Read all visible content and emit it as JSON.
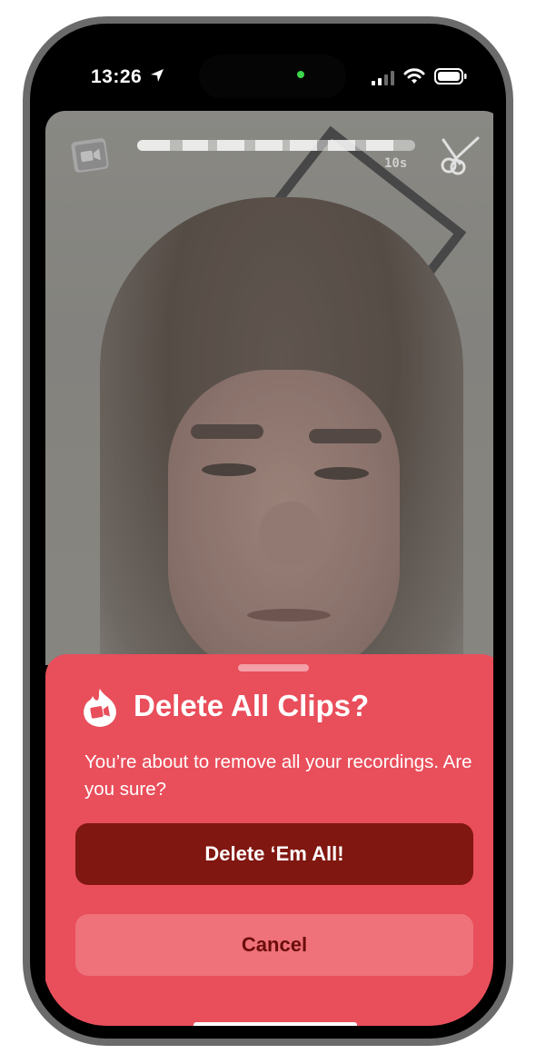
{
  "status_bar": {
    "time": "13:26",
    "icons": [
      "location-arrow-icon",
      "cellular-signal-icon",
      "wifi-icon",
      "battery-icon"
    ]
  },
  "recorder": {
    "clip_icon": "video-clip-icon",
    "progress": 0.96,
    "duration": "10s",
    "trim_icon": "scissors-icon"
  },
  "sheet": {
    "icon": "flame-icon",
    "title": "Delete All Clips?",
    "message": "You’re about to remove all your recordings. Are you sure?",
    "delete_label": "Delete ‘Em All!",
    "cancel_label": "Cancel"
  },
  "colors": {
    "sheet_bg": "#e94e5b",
    "delete_bg": "#801710",
    "cancel_bg": "#ef717a",
    "cancel_text": "#6a0d0b"
  }
}
